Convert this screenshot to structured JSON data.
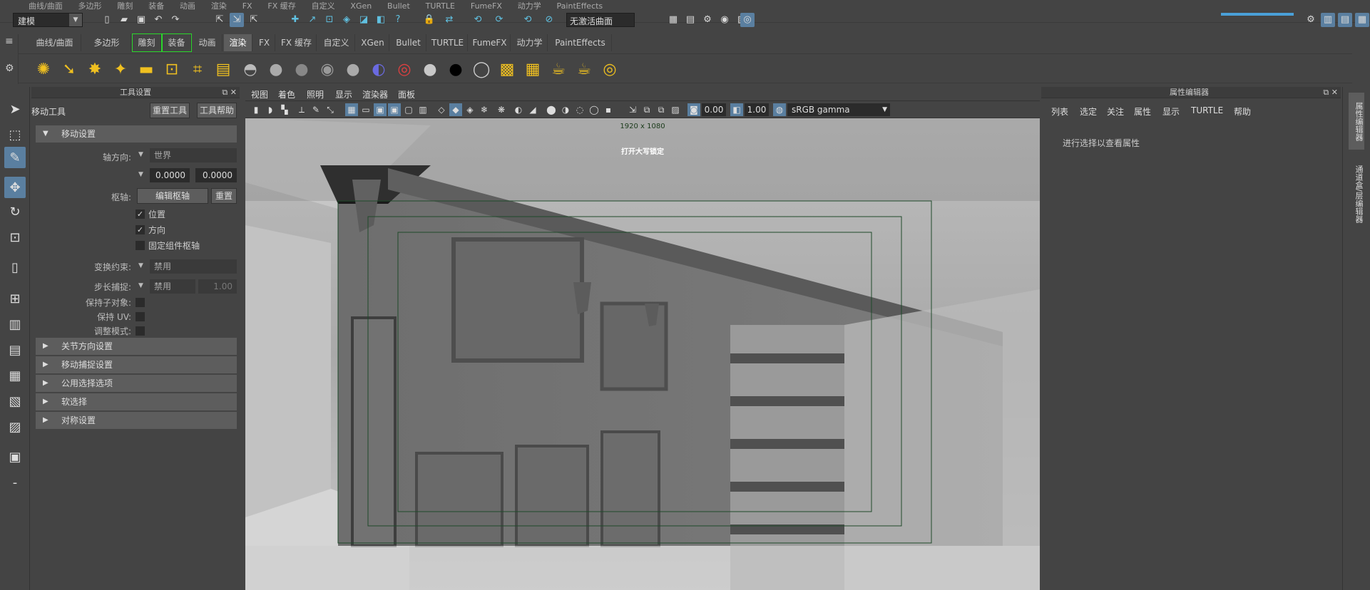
{
  "status_line": {
    "hidden_tabs": [
      "曲线/曲面",
      "多边形",
      "雕刻",
      "装备",
      "动画",
      "渲染",
      "FX",
      "FX 缓存",
      "自定义",
      "XGen",
      "Bullet",
      "TURTLE",
      "FumeFX",
      "动力学",
      "PaintEffects"
    ],
    "mode": "建模",
    "live_surface": "无激活曲面"
  },
  "shelf": {
    "tabs": [
      "曲线/曲面",
      "多边形",
      "雕刻",
      "装备",
      "动画",
      "渲染",
      "FX",
      "FX 缓存",
      "自定义",
      "XGen",
      "Bullet",
      "TURTLE",
      "FumeFX",
      "动力学",
      "PaintEffects"
    ],
    "active_tab": "渲染",
    "highlighted_tabs": [
      "雕刻",
      "装备"
    ]
  },
  "tool_settings": {
    "panel_title": "工具设置",
    "tool_name": "移动工具",
    "reset_button": "重置工具",
    "help_button": "工具帮助",
    "move_settings": {
      "section": "移动设置",
      "axis_orientation_label": "轴方向:",
      "axis_orientation_value": "世界",
      "value_1": "0.0000",
      "value_2": "0.0000",
      "pivot_label": "枢轴:",
      "edit_pivot_button": "编辑枢轴",
      "reset_pivot_button": "重置",
      "position_checkbox": "位置",
      "orientation_checkbox": "方向",
      "pin_pivot_checkbox": "固定组件枢轴",
      "transform_constraint_label": "变换约束:",
      "transform_constraint_value": "禁用",
      "step_snap_label": "步长捕捉:",
      "step_snap_value": "禁用",
      "step_snap_amount": "1.00",
      "preserve_children_label": "保持子对象:",
      "preserve_uvs_label": "保持 UV:",
      "tweak_mode_label": "调整模式:"
    },
    "collapsed_sections": [
      "关节方向设置",
      "移动捕捉设置",
      "公用选择选项",
      "软选择",
      "对称设置"
    ]
  },
  "viewport": {
    "menus": [
      "视图",
      "着色",
      "照明",
      "显示",
      "渲染器",
      "面板"
    ],
    "exposure": "0.00",
    "gamma": "1.00",
    "color_space": "sRGB gamma",
    "resolution_gate_label": "1920 x 1080",
    "message": "打开大写锁定"
  },
  "attribute_editor": {
    "title": "属性编辑器",
    "menus": [
      "列表",
      "选定",
      "关注",
      "属性",
      "显示",
      "TURTLE",
      "帮助"
    ],
    "empty_message": "进行选择以查看属性"
  },
  "side_tabs": [
    "属性编辑器",
    "通道盒/层编辑器"
  ],
  "colors": {
    "panel": "#444444",
    "highlight": "#5a7fa0",
    "active_tab_outline": "#2bd62b",
    "gate_line": "#1f4a2a"
  }
}
